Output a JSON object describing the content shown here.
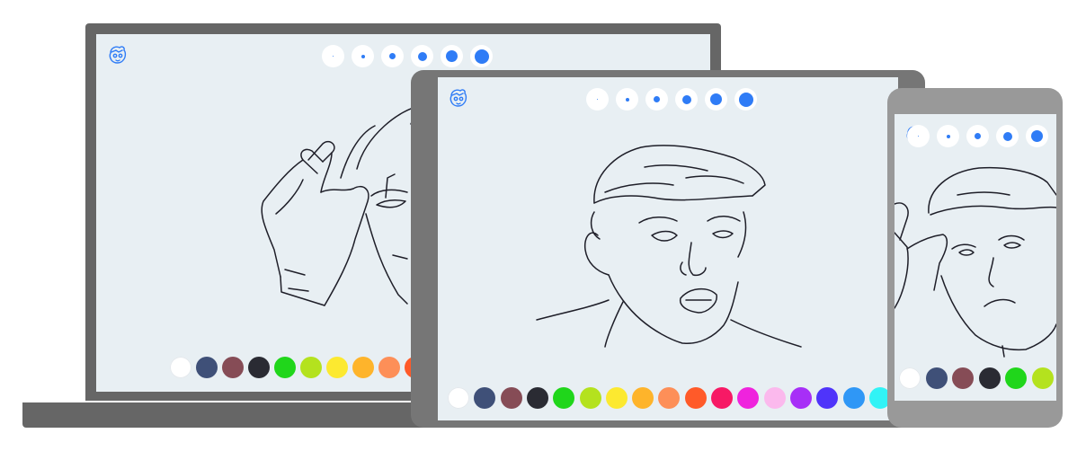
{
  "app": {
    "logo_icon": "cartoon-face-logo-icon",
    "accent_color": "#2f7cf6",
    "canvas_color": "#e8eff3"
  },
  "brush_sizes": [
    1,
    3,
    5,
    7,
    9,
    11
  ],
  "palette": [
    {
      "name": "white",
      "hex": "#ffffff"
    },
    {
      "name": "slate-blue",
      "hex": "#3f5078"
    },
    {
      "name": "mauve",
      "hex": "#864c56"
    },
    {
      "name": "charcoal",
      "hex": "#2a2b33"
    },
    {
      "name": "green",
      "hex": "#20d61b"
    },
    {
      "name": "lime",
      "hex": "#b4e21e"
    },
    {
      "name": "yellow",
      "hex": "#fce930"
    },
    {
      "name": "amber",
      "hex": "#feb42b"
    },
    {
      "name": "salmon",
      "hex": "#fd8f58"
    },
    {
      "name": "red-orange",
      "hex": "#ff5a29"
    },
    {
      "name": "crimson",
      "hex": "#f71965"
    },
    {
      "name": "magenta",
      "hex": "#ef23dd"
    },
    {
      "name": "pink",
      "hex": "#fbb9ed"
    },
    {
      "name": "purple",
      "hex": "#a72ff7"
    },
    {
      "name": "indigo",
      "hex": "#4f34fa"
    },
    {
      "name": "sky-blue",
      "hex": "#2f97f6"
    },
    {
      "name": "cyan",
      "hex": "#31f3f6"
    }
  ],
  "devices": [
    "laptop",
    "tablet",
    "phone"
  ]
}
